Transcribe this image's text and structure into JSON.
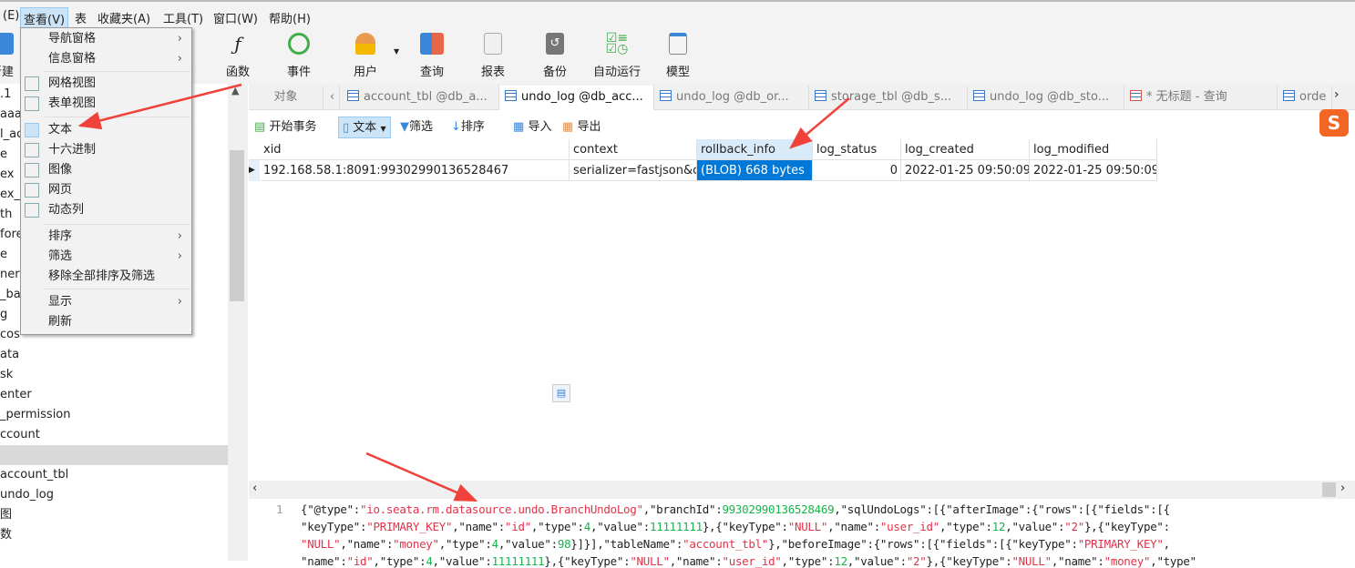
{
  "menubar": {
    "items": [
      "(E)",
      "查看(V)",
      "表",
      "收藏夹(A)",
      "工具(T)",
      "窗口(W)",
      "帮助(H)"
    ]
  },
  "toolbar": {
    "items": [
      "新建",
      "函数",
      "事件",
      "用户",
      "查询",
      "报表",
      "备份",
      "自动运行",
      "模型"
    ]
  },
  "view_menu": {
    "items": [
      {
        "label": "导航窗格",
        "submenu": true
      },
      {
        "label": "信息窗格",
        "submenu": true
      },
      {
        "label": "网格视图"
      },
      {
        "label": "表单视图"
      },
      {
        "label": "文本",
        "checked": true
      },
      {
        "label": "十六进制"
      },
      {
        "label": "图像"
      },
      {
        "label": "网页"
      },
      {
        "label": "动态列"
      },
      {
        "label": "排序",
        "submenu": true
      },
      {
        "label": "筛选",
        "submenu": true
      },
      {
        "label": "移除全部排序及筛选"
      },
      {
        "label": "显示",
        "submenu": true
      },
      {
        "label": "刷新"
      }
    ]
  },
  "sidebar": {
    "items": [
      ".1",
      "aaaa",
      "l_ac",
      "e",
      "ex",
      "ex_l",
      "th",
      "fore",
      "e",
      "ner",
      "_ba",
      "g",
      "cos",
      "ata",
      "sk",
      "enter",
      "_permission",
      "ccount",
      "",
      "account_tbl",
      "undo_log",
      "图",
      "数"
    ]
  },
  "tabs": {
    "objects": "对象",
    "items": [
      "account_tbl @db_a...",
      "undo_log @db_acc...",
      "undo_log @db_or...",
      "storage_tbl @db_s...",
      "undo_log @db_sto...",
      "* 无标题 - 查询",
      "orde"
    ],
    "active": 1
  },
  "data_toolbar": {
    "begin_tx": "开始事务",
    "text": "文本",
    "filter": "筛选",
    "sort": "排序",
    "import": "导入",
    "export": "导出"
  },
  "grid": {
    "columns": [
      "xid",
      "context",
      "rollback_info",
      "log_status",
      "log_created",
      "log_modified"
    ],
    "rows": [
      [
        "192.168.58.1:8091:99302990136528467",
        "serializer=fastjson&c",
        "(BLOB) 668 bytes",
        "0",
        "2022-01-25 09:50:09",
        "2022-01-25 09:50:09"
      ]
    ]
  },
  "editor": {
    "line_number": "1",
    "lines": [
      [
        [
          "k",
          "{\"@type\":"
        ],
        [
          "s",
          "\"io.seata.rm.datasource.undo.BranchUndoLog\""
        ],
        [
          "k",
          ",\"branchId\":"
        ],
        [
          "n",
          "99302990136528469"
        ],
        [
          "k",
          ",\"sqlUndoLogs\":[{\"afterImage\":{\"rows\":[{\"fields\":[{"
        ]
      ],
      [
        [
          "k",
          "\"keyType\":"
        ],
        [
          "s",
          "\"PRIMARY_KEY\""
        ],
        [
          "k",
          ",\"name\":"
        ],
        [
          "s",
          "\"id\""
        ],
        [
          "k",
          ",\"type\":"
        ],
        [
          "n",
          "4"
        ],
        [
          "k",
          ",\"value\":"
        ],
        [
          "n",
          "11111111"
        ],
        [
          "k",
          "},{\"keyType\":"
        ],
        [
          "s",
          "\"NULL\""
        ],
        [
          "k",
          ",\"name\":"
        ],
        [
          "s",
          "\"user_id\""
        ],
        [
          "k",
          ",\"type\":"
        ],
        [
          "n",
          "12"
        ],
        [
          "k",
          ",\"value\":"
        ],
        [
          "s",
          "\"2\""
        ],
        [
          "k",
          "},{\"keyType\":"
        ]
      ],
      [
        [
          "s",
          "\"NULL\""
        ],
        [
          "k",
          ",\"name\":"
        ],
        [
          "s",
          "\"money\""
        ],
        [
          "k",
          ",\"type\":"
        ],
        [
          "n",
          "4"
        ],
        [
          "k",
          ",\"value\":"
        ],
        [
          "n",
          "98"
        ],
        [
          "k",
          "}]}],\"tableName\":"
        ],
        [
          "s",
          "\"account_tbl\""
        ],
        [
          "k",
          "},\"beforeImage\":{\"rows\":[{\"fields\":[{\"keyType\":"
        ],
        [
          "s",
          "\"PRIMARY_KEY\""
        ],
        [
          "k",
          ","
        ]
      ],
      [
        [
          "k",
          "\"name\":"
        ],
        [
          "s",
          "\"id\""
        ],
        [
          "k",
          ",\"type\":"
        ],
        [
          "n",
          "4"
        ],
        [
          "k",
          ",\"value\":"
        ],
        [
          "n",
          "11111111"
        ],
        [
          "k",
          "},{\"keyType\":"
        ],
        [
          "s",
          "\"NULL\""
        ],
        [
          "k",
          ",\"name\":"
        ],
        [
          "s",
          "\"user_id\""
        ],
        [
          "k",
          ",\"type\":"
        ],
        [
          "n",
          "12"
        ],
        [
          "k",
          ",\"value\":"
        ],
        [
          "s",
          "\"2\""
        ],
        [
          "k",
          "},{\"keyType\":"
        ],
        [
          "s",
          "\"NULL\""
        ],
        [
          "k",
          ",\"name\":"
        ],
        [
          "s",
          "\"money\""
        ],
        [
          "k",
          ",\"type\""
        ]
      ]
    ]
  },
  "colors": {
    "selection": "#0078d7",
    "annotation_arrow": "#f0413a",
    "string": "#e0344a",
    "number": "#19b34c"
  }
}
